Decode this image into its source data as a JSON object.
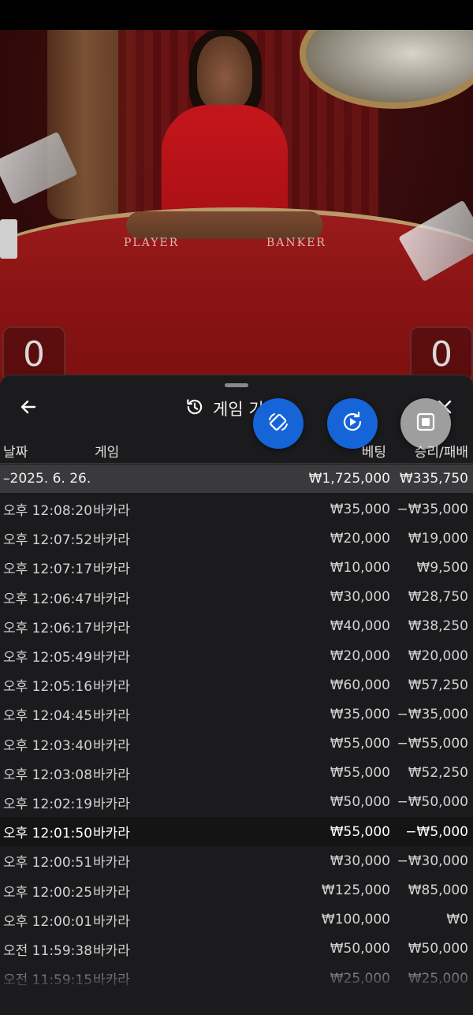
{
  "video": {
    "table_labels": {
      "player": "PLAYER",
      "banker": "BANKER"
    },
    "scores": {
      "left": "0",
      "right": "0"
    }
  },
  "panel": {
    "title": "게임 기록",
    "icons": {
      "back": "back-arrow-icon",
      "history": "history-clock-icon",
      "close": "close-icon",
      "fab1": "rotate-portrait-icon",
      "fab2": "replay-play-icon",
      "fab3": "stop-square-icon"
    },
    "columns": {
      "date": "날짜",
      "game": "게임",
      "bet": "베팅",
      "win_loss": "승리/패배"
    },
    "day": {
      "date": "–2025. 6. 26.",
      "bet_total": "₩1,725,000",
      "win_total": "₩335,750"
    },
    "rows": [
      {
        "time": "오후 12:08:20",
        "game": "바카라",
        "bet": "₩35,000",
        "result": "−₩35,000"
      },
      {
        "time": "오후 12:07:52",
        "game": "바카라",
        "bet": "₩20,000",
        "result": "₩19,000"
      },
      {
        "time": "오후 12:07:17",
        "game": "바카라",
        "bet": "₩10,000",
        "result": "₩9,500"
      },
      {
        "time": "오후 12:06:47",
        "game": "바카라",
        "bet": "₩30,000",
        "result": "₩28,750"
      },
      {
        "time": "오후 12:06:17",
        "game": "바카라",
        "bet": "₩40,000",
        "result": "₩38,250"
      },
      {
        "time": "오후 12:05:49",
        "game": "바카라",
        "bet": "₩20,000",
        "result": "₩20,000"
      },
      {
        "time": "오후 12:05:16",
        "game": "바카라",
        "bet": "₩60,000",
        "result": "₩57,250"
      },
      {
        "time": "오후 12:04:45",
        "game": "바카라",
        "bet": "₩35,000",
        "result": "−₩35,000"
      },
      {
        "time": "오후 12:03:40",
        "game": "바카라",
        "bet": "₩55,000",
        "result": "−₩55,000"
      },
      {
        "time": "오후 12:03:08",
        "game": "바카라",
        "bet": "₩55,000",
        "result": "₩52,250"
      },
      {
        "time": "오후 12:02:19",
        "game": "바카라",
        "bet": "₩50,000",
        "result": "−₩50,000"
      },
      {
        "time": "오후 12:01:50",
        "game": "바카라",
        "bet": "₩55,000",
        "result": "−₩5,000"
      },
      {
        "time": "오후 12:00:51",
        "game": "바카라",
        "bet": "₩30,000",
        "result": "−₩30,000"
      },
      {
        "time": "오후 12:00:25",
        "game": "바카라",
        "bet": "₩125,000",
        "result": "₩85,000"
      },
      {
        "time": "오후 12:00:01",
        "game": "바카라",
        "bet": "₩100,000",
        "result": "₩0"
      },
      {
        "time": "오전 11:59:38",
        "game": "바카라",
        "bet": "₩50,000",
        "result": "₩50,000"
      },
      {
        "time": "오전 11:59:15",
        "game": "바카라",
        "bet": "₩25,000",
        "result": "₩25,000"
      }
    ],
    "highlighted_row": 11
  }
}
